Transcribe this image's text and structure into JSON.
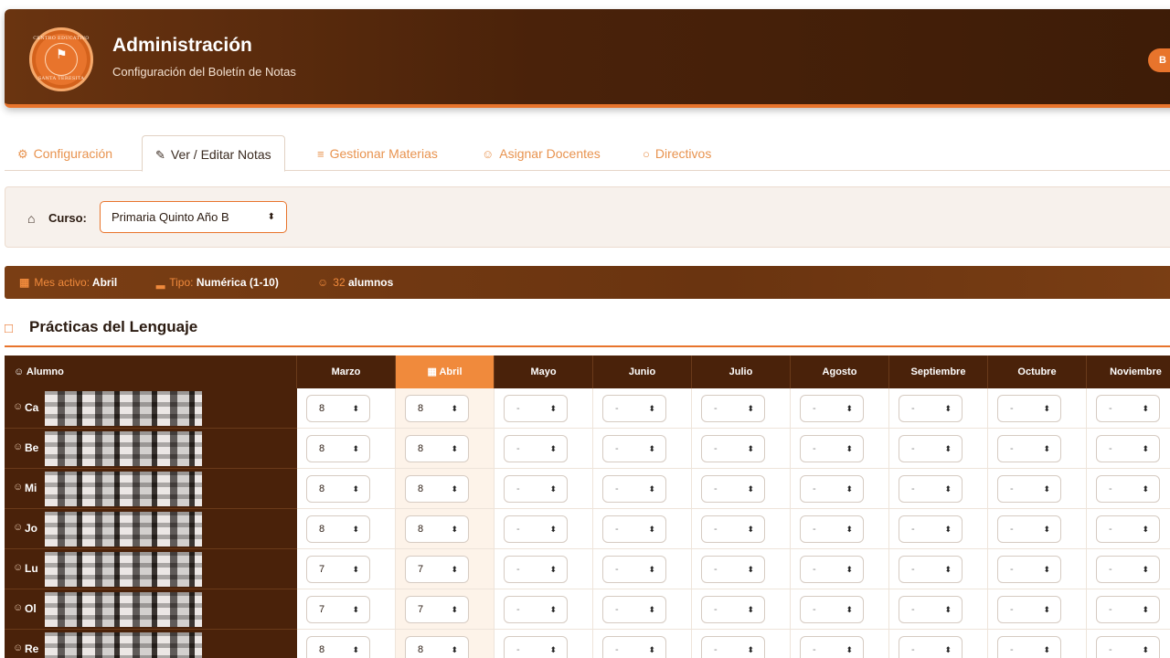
{
  "header": {
    "title": "Administración",
    "subtitle": "Configuración del Boletín de Notas",
    "logo_top": "CENTRO EDUCATIVO",
    "logo_bottom": "SANTA TERESITA",
    "button_label": "B"
  },
  "tabs": [
    {
      "label": "Configuración",
      "icon": "gear-icon"
    },
    {
      "label": "Ver / Editar Notas",
      "icon": "edit-icon"
    },
    {
      "label": "Gestionar Materias",
      "icon": "list-icon"
    },
    {
      "label": "Asignar Docentes",
      "icon": "user-check-icon"
    },
    {
      "label": "Directivos",
      "icon": "circle-icon"
    }
  ],
  "course": {
    "label": "Curso:",
    "value": "Primaria Quinto Año B"
  },
  "info": {
    "mes_key": "Mes activo:",
    "mes_val": "Abril",
    "tipo_key": "Tipo:",
    "tipo_val": "Numérica (1-10)",
    "count_num": "32",
    "count_word": "alumnos"
  },
  "section_title": "Prácticas del Lenguaje",
  "table": {
    "name_header": "Alumno",
    "months": [
      "Marzo",
      "Abril",
      "Mayo",
      "Junio",
      "Julio",
      "Agosto",
      "Septiembre",
      "Octubre",
      "Noviembre"
    ],
    "active_month": "Abril",
    "rows": [
      {
        "initial": "Ca",
        "grades": [
          "8",
          "8",
          "-",
          "-",
          "-",
          "-",
          "-",
          "-",
          "-"
        ]
      },
      {
        "initial": "Be",
        "grades": [
          "8",
          "8",
          "-",
          "-",
          "-",
          "-",
          "-",
          "-",
          "-"
        ]
      },
      {
        "initial": "Mi",
        "grades": [
          "8",
          "8",
          "-",
          "-",
          "-",
          "-",
          "-",
          "-",
          "-"
        ]
      },
      {
        "initial": "Jo",
        "grades": [
          "8",
          "8",
          "-",
          "-",
          "-",
          "-",
          "-",
          "-",
          "-"
        ]
      },
      {
        "initial": "Lu",
        "grades": [
          "7",
          "7",
          "-",
          "-",
          "-",
          "-",
          "-",
          "-",
          "-"
        ]
      },
      {
        "initial": "Ol",
        "grades": [
          "7",
          "7",
          "-",
          "-",
          "-",
          "-",
          "-",
          "-",
          "-"
        ]
      },
      {
        "initial": "Re",
        "grades": [
          "8",
          "8",
          "-",
          "-",
          "-",
          "-",
          "-",
          "-",
          "-"
        ]
      }
    ]
  },
  "colors": {
    "accent": "#e8742c",
    "header_dark": "#4a220a",
    "active_col": "#f08a3c"
  }
}
